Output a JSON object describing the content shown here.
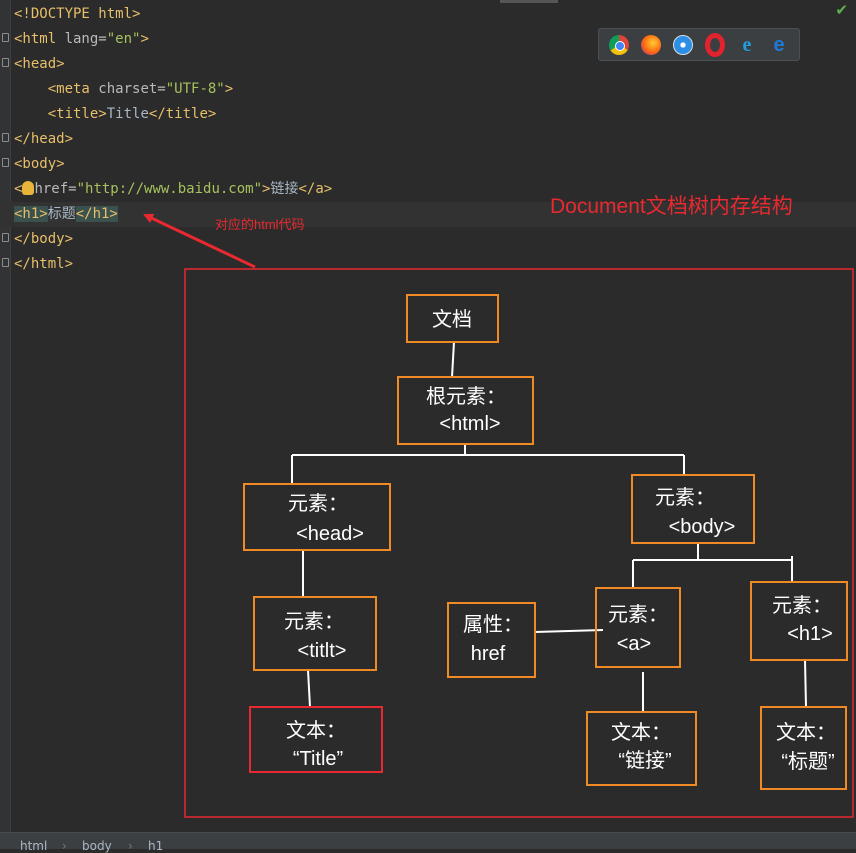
{
  "code_lines": [
    [
      {
        "c": "tg",
        "t": "<!DOCTYPE html>"
      }
    ],
    [
      {
        "c": "tg",
        "t": "<html "
      },
      {
        "c": "at",
        "t": "lang="
      },
      {
        "c": "vl",
        "t": "\"en\""
      },
      {
        "c": "tg",
        "t": ">"
      }
    ],
    [
      {
        "c": "tg",
        "t": "<head>"
      }
    ],
    [
      {
        "c": "tx",
        "t": "    "
      },
      {
        "c": "tg",
        "t": "<meta "
      },
      {
        "c": "at",
        "t": "charset="
      },
      {
        "c": "vl",
        "t": "\"UTF-8\""
      },
      {
        "c": "tg",
        "t": ">"
      }
    ],
    [
      {
        "c": "tx",
        "t": "    "
      },
      {
        "c": "tg",
        "t": "<title>"
      },
      {
        "c": "tx",
        "t": "Title"
      },
      {
        "c": "tg",
        "t": "</title>"
      }
    ],
    [
      {
        "c": "tg",
        "t": "</head>"
      }
    ],
    [
      {
        "c": "tg",
        "t": "<body>"
      }
    ],
    [
      {
        "c": "tg",
        "t": "<"
      },
      {
        "c": "bulb",
        "t": ""
      },
      {
        "c": "at",
        "t": "href="
      },
      {
        "c": "vl",
        "t": "\"http://www.baidu.com\""
      },
      {
        "c": "tg",
        "t": ">"
      },
      {
        "c": "tx",
        "t": "链接"
      },
      {
        "c": "tg",
        "t": "</a>"
      }
    ],
    [
      {
        "c": "tg hl",
        "t": "<h1>"
      },
      {
        "c": "tx",
        "t": "标题"
      },
      {
        "c": "tg hl",
        "t": "</h1>"
      }
    ],
    [
      {
        "c": "tg",
        "t": "</body>"
      }
    ],
    [
      {
        "c": "tg",
        "t": "</html>"
      }
    ]
  ],
  "annotation": {
    "title": "Document文档树内存结构",
    "subtitle": "对应的html代码"
  },
  "browser_icons": [
    "chrome-icon",
    "firefox-icon",
    "safari-icon",
    "opera-icon",
    "ie-icon",
    "edge-icon"
  ],
  "breadcrumbs": [
    "html",
    "body",
    "h1"
  ],
  "colors": {
    "node_border": "#f08a24",
    "highlight_border": "#e8292f",
    "frame_border": "#e8292f",
    "connector": "#ffffff"
  },
  "tree": {
    "doc": {
      "lines": [
        "文档"
      ]
    },
    "root": {
      "lines": [
        "根元素：",
        "<html>"
      ]
    },
    "head": {
      "lines": [
        "元素：",
        "<head>"
      ]
    },
    "body": {
      "lines": [
        "元素：",
        "<body>"
      ]
    },
    "title_el": {
      "lines": [
        "元素：",
        "<titlt>"
      ]
    },
    "attr": {
      "lines": [
        "属性：",
        "href"
      ]
    },
    "a_el": {
      "lines": [
        "元素：",
        "<a>"
      ]
    },
    "h1_el": {
      "lines": [
        "元素：",
        "<h1>"
      ]
    },
    "text_title": {
      "lines": [
        "文本：",
        "“Title”"
      ]
    },
    "text_link": {
      "lines": [
        "文本：",
        "“链接”"
      ]
    },
    "text_h1": {
      "lines": [
        "文本：",
        "“标题”"
      ]
    }
  }
}
